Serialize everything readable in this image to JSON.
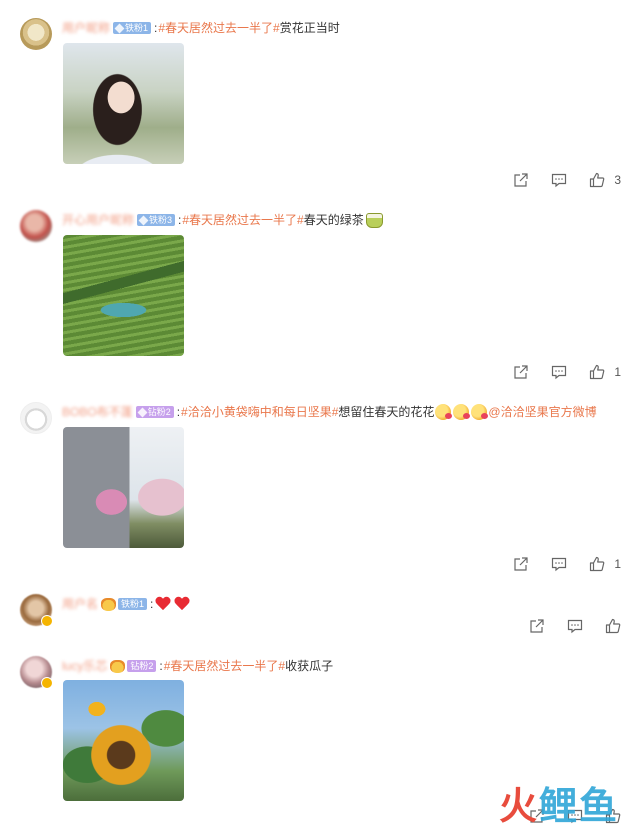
{
  "colors": {
    "topic": "#e9774b",
    "username": "#f29f86",
    "badge_blue": "#8cb5e8",
    "badge_purple": "#c6a0ec"
  },
  "comments": [
    {
      "badge": "铁粉1",
      "topic": "#春天居然过去一半了#",
      "text": " 赏花正当时",
      "actions": {
        "share_icon": "share-icon",
        "comment_icon": "comment-icon",
        "like_icon": "like-icon",
        "like_count": "3"
      }
    },
    {
      "badge": "铁粉3",
      "topic": "#春天居然过去一半了#",
      "text": " 春天的绿茶",
      "actions": {
        "like_count": "1"
      }
    },
    {
      "username": "BOBO布不蓬",
      "badge": "钻粉2",
      "topic": "#洽洽小黄袋嗨中和每日坚果#",
      "text": "想留住春天的花花",
      "at": "@洽洽坚果官方微博",
      "actions": {
        "like_count": "1"
      }
    },
    {
      "badge": "铁粉1",
      "actions": {
        "like_count": ""
      }
    },
    {
      "username": "lucy乐芯",
      "badge": "钻粉2",
      "topic": "#春天居然过去一半了#",
      "text": "收获瓜子"
    }
  ],
  "watermark": {
    "part1": "火",
    "part2": "鲤鱼"
  }
}
